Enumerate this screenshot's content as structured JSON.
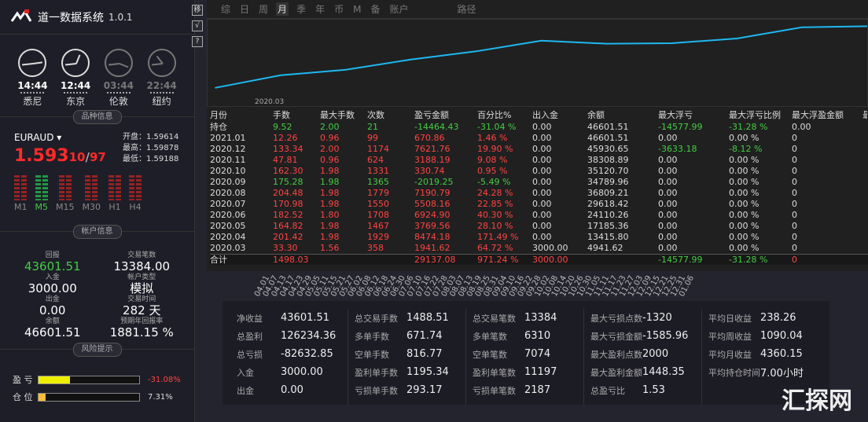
{
  "app": {
    "title": "道一数据系统",
    "version": "1.0.1",
    "logo": "道一-logo"
  },
  "clocks": [
    {
      "time": "14:44",
      "city": "悉尼",
      "active": true
    },
    {
      "time": "12:44",
      "city": "东京",
      "active": true
    },
    {
      "time": "03:44",
      "city": "伦敦",
      "active": false
    },
    {
      "time": "22:44",
      "city": "纽约",
      "active": false
    }
  ],
  "symbol_section": {
    "title": "品种信息",
    "symbol": "EURAUD",
    "price_main": "1.593",
    "price_a": "10",
    "price_sep": "/",
    "price_b": "97",
    "open": "开盘：1.59614",
    "high": "最高：1.59878",
    "low": "最低：1.59188",
    "timeframes": [
      "M1",
      "M5",
      "M15",
      "M30",
      "H1",
      "H4"
    ],
    "active_tf": "M5"
  },
  "account_section": {
    "title": "帐户信息",
    "items": [
      {
        "label": "回报",
        "value": "43601.51"
      },
      {
        "label": "交易笔数",
        "value": "13384.00"
      },
      {
        "label": "入金",
        "value": "3000.00"
      },
      {
        "label": "帐户类型",
        "value": "模拟"
      },
      {
        "label": "出金",
        "value": "0.00"
      },
      {
        "label": "交易时间",
        "value": "282 天"
      },
      {
        "label": "余额",
        "value": "46601.51"
      },
      {
        "label": "预期年回报率",
        "value": "1881.15 %"
      }
    ]
  },
  "risk_section": {
    "title": "风险提示",
    "items": [
      {
        "name": "盈 亏",
        "value": "-31.08%",
        "fill": 0.31
      },
      {
        "name": "仓 位",
        "value": "7.31%",
        "fill": 0.0731
      }
    ]
  },
  "toolbar": {
    "buttons": [
      "移",
      "√",
      "?"
    ]
  },
  "tabs": [
    "综",
    "日",
    "周",
    "月",
    "季",
    "年",
    "币",
    "M",
    "备",
    "账户",
    "路径"
  ],
  "active_tab": "月",
  "chart_data": {
    "type": "line",
    "x": [
      "2020.03",
      "2020.04",
      "2020.05",
      "2020.06",
      "2020.07",
      "2020.08",
      "2020.09",
      "2020.10",
      "2020.11",
      "2020.12",
      "2021.01"
    ],
    "values": [
      4941.62,
      13415.8,
      17185.36,
      24110.26,
      29618.42,
      36809.21,
      34789.96,
      35120.7,
      38308.89,
      45930.65,
      46601.51
    ],
    "xlabel_shown": "2020.03",
    "color": "#1eb8f0"
  },
  "table": {
    "headers": [
      "月份",
      "手数",
      "最大手数",
      "次数",
      "盈亏金额",
      "百分比%",
      "出入金",
      "余额",
      "最大浮亏",
      "最大浮亏比例",
      "最大浮盈金额",
      "最"
    ],
    "hold": [
      "持仓",
      "9.52",
      "2.00",
      "21",
      "-14464.43",
      "-31.04 %",
      "0.00",
      "46601.51",
      "-14577.99",
      "-31.28 %",
      "0.00",
      ""
    ],
    "rows": [
      [
        "2021.01",
        "12.26",
        "0.96",
        "99",
        "670.86",
        "1.46 %",
        "0.00",
        "46601.51",
        "0.00",
        "0.00 %",
        "0",
        ""
      ],
      [
        "2020.12",
        "133.34",
        "2.00",
        "1174",
        "7621.76",
        "19.90 %",
        "0.00",
        "45930.65",
        "-3633.18",
        "-8.12 %",
        "0",
        ""
      ],
      [
        "2020.11",
        "47.81",
        "0.96",
        "624",
        "3188.19",
        "9.08 %",
        "0.00",
        "38308.89",
        "0.00",
        "0.00 %",
        "0",
        ""
      ],
      [
        "2020.10",
        "162.30",
        "1.98",
        "1331",
        "330.74",
        "0.95 %",
        "0.00",
        "35120.70",
        "0.00",
        "0.00 %",
        "0",
        ""
      ],
      [
        "2020.09",
        "175.28",
        "1.98",
        "1365",
        "-2019.25",
        "-5.49 %",
        "0.00",
        "34789.96",
        "0.00",
        "0.00 %",
        "0",
        ""
      ],
      [
        "2020.08",
        "204.48",
        "1.98",
        "1779",
        "7190.79",
        "24.28 %",
        "0.00",
        "36809.21",
        "0.00",
        "0.00 %",
        "0",
        ""
      ],
      [
        "2020.07",
        "170.98",
        "1.98",
        "1550",
        "5508.16",
        "22.85 %",
        "0.00",
        "29618.42",
        "0.00",
        "0.00 %",
        "0",
        ""
      ],
      [
        "2020.06",
        "182.52",
        "1.80",
        "1708",
        "6924.90",
        "40.30 %",
        "0.00",
        "24110.26",
        "0.00",
        "0.00 %",
        "0",
        ""
      ],
      [
        "2020.05",
        "164.82",
        "1.98",
        "1467",
        "3769.56",
        "28.10 %",
        "0.00",
        "17185.36",
        "0.00",
        "0.00 %",
        "0",
        ""
      ],
      [
        "2020.04",
        "201.42",
        "1.98",
        "1929",
        "8474.18",
        "171.49 %",
        "0.00",
        "13415.80",
        "0.00",
        "0.00 %",
        "0",
        ""
      ],
      [
        "2020.03",
        "33.30",
        "1.56",
        "358",
        "1941.62",
        "64.72 %",
        "3000.00",
        "4941.62",
        "0.00",
        "0.00 %",
        "0",
        ""
      ]
    ],
    "total": [
      "合计",
      "1498.03",
      "",
      "",
      "29137.08",
      "971.24 %",
      "3000.00",
      "",
      "-14577.99",
      "-31.28 %",
      "0",
      ""
    ]
  },
  "dates": [
    "04.01",
    "04.07",
    "04.13",
    "04.17",
    "04.23",
    "04.29",
    "05.05",
    "05.11",
    "05.15",
    "05.21",
    "05.27",
    "06.02",
    "06.08",
    "06.12",
    "06.18",
    "06.24",
    "06.30",
    "07.06",
    "07.10",
    "07.16",
    "07.22",
    "07.28",
    "08.03",
    "08.07",
    "08.13",
    "08.19",
    "08.25",
    "08.31",
    "09.04",
    "09.10",
    "09.16",
    "09.22",
    "09.28",
    "10.02",
    "10.08",
    "10.14",
    "10.20",
    "10.26",
    "10.30",
    "11.05",
    "11.11",
    "11.17",
    "11.23",
    "11.27",
    "12.03",
    "12.09",
    "12.15",
    "12.21",
    "12.25",
    "12.31",
    "01.06"
  ],
  "stats": [
    [
      [
        "净收益",
        "43601.51"
      ],
      [
        "总盈利",
        "126234.36"
      ],
      [
        "总亏损",
        "-82632.85"
      ],
      [
        "入金",
        "3000.00"
      ],
      [
        "出金",
        "0.00"
      ]
    ],
    [
      [
        "总交易手数",
        "1488.51"
      ],
      [
        "多单手数",
        "671.74"
      ],
      [
        "空单手数",
        "816.77"
      ],
      [
        "盈利单手数",
        "1195.34"
      ],
      [
        "亏损单手数",
        "293.17"
      ]
    ],
    [
      [
        "总交易笔数",
        "13384"
      ],
      [
        "多单笔数",
        "6310"
      ],
      [
        "空单笔数",
        "7074"
      ],
      [
        "盈利单笔数",
        "11197"
      ],
      [
        "亏损单笔数",
        "2187"
      ]
    ],
    [
      [
        "最大亏损点数",
        "-1320"
      ],
      [
        "最大亏损金额",
        "-1585.96"
      ],
      [
        "最大盈利点数",
        "2000"
      ],
      [
        "最大盈利金额",
        "1448.35"
      ],
      [
        "总盈亏比",
        "1.53"
      ]
    ],
    [
      [
        "平均日收益",
        "238.26"
      ],
      [
        "平均周收益",
        "1090.04"
      ],
      [
        "平均月收益",
        "4360.15"
      ],
      [
        "平均持仓时间",
        "7.00小时"
      ]
    ]
  ],
  "watermark": "汇探网"
}
